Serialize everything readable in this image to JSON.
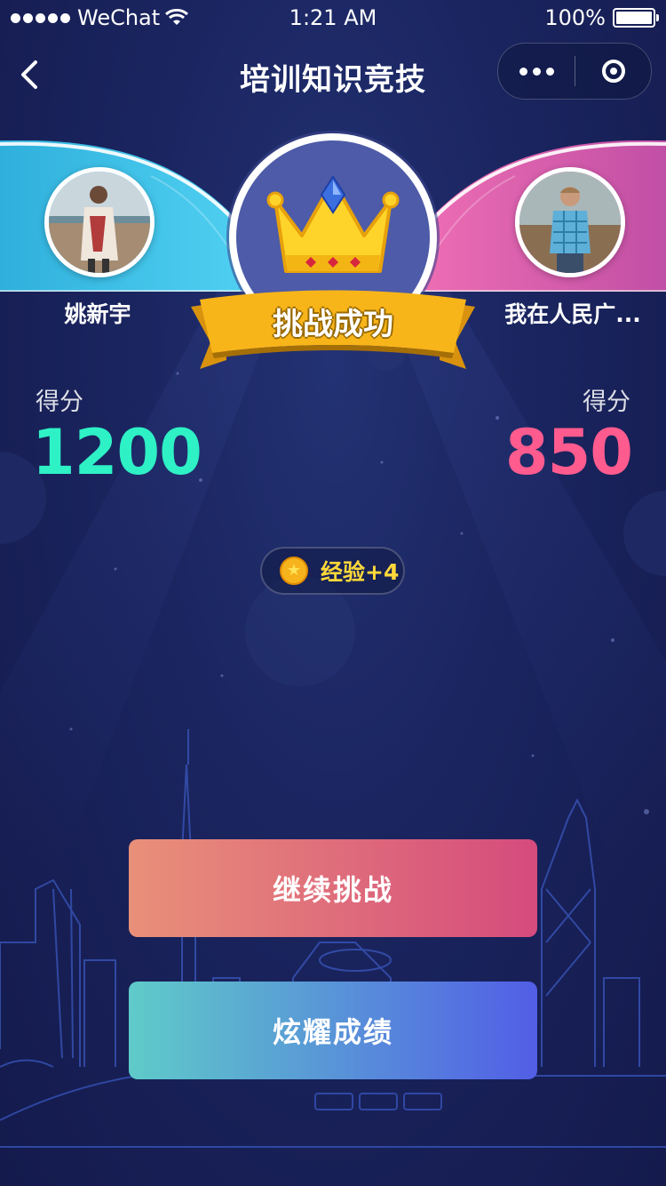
{
  "status_bar": {
    "carrier": "WeChat",
    "time": "1:21 AM",
    "battery": "100%",
    "signal_icon": "signal-dots-icon",
    "wifi_icon": "wifi-icon",
    "battery_icon": "battery-icon"
  },
  "nav": {
    "title": "培训知识竞技",
    "back_icon": "chevron-left-icon",
    "more_icon": "more-dots-icon",
    "close_icon": "target-circle-icon"
  },
  "result": {
    "banner": "挑战成功",
    "crown_icon": "crown-icon"
  },
  "players": {
    "left": {
      "name": "姚新宇",
      "score_label": "得分",
      "score": "1200",
      "color": "#2ef1c6"
    },
    "right": {
      "name": "我在人民广...",
      "score_label": "得分",
      "score": "850",
      "color": "#ff5b8e"
    }
  },
  "reward": {
    "text": "经验+4",
    "icon": "star-coin-icon"
  },
  "actions": {
    "continue_label": "继续挑战",
    "share_label": "炫耀成绩"
  },
  "colors": {
    "background": "#1a245e",
    "left_wing": "#3fc7ea",
    "right_wing": "#f06aa9",
    "ribbon": "#f8b51a",
    "crown_circle": "#4d5ba8"
  }
}
